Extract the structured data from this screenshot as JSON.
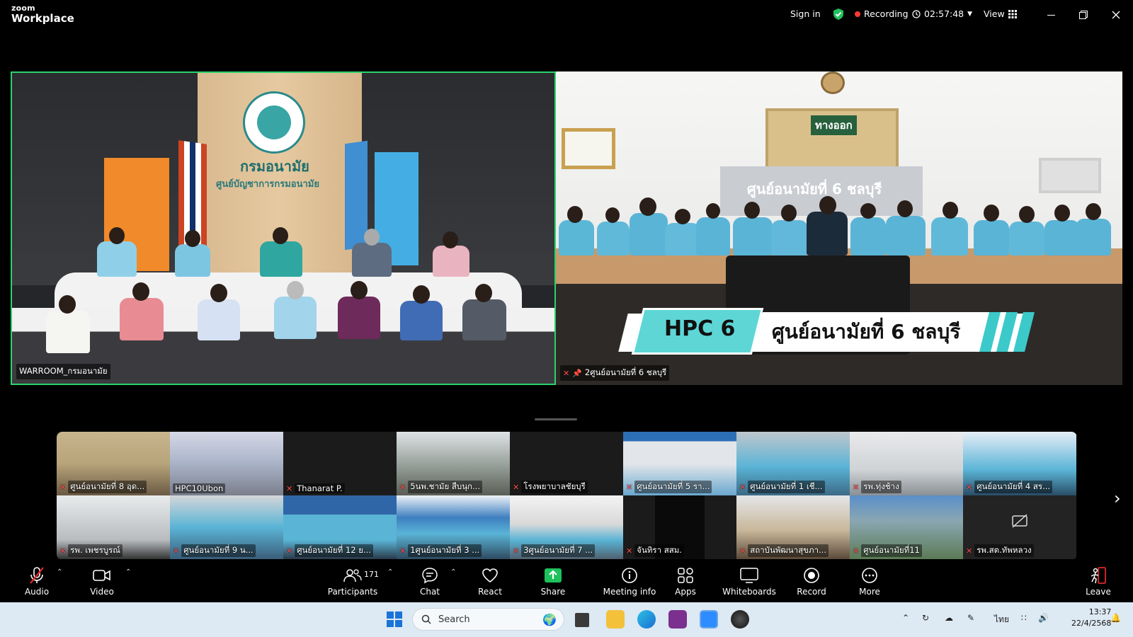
{
  "app": {
    "logo_top": "zoom",
    "logo_bottom": "Workplace"
  },
  "titlebar": {
    "sign_in": "Sign in",
    "recording": "Recording",
    "timer": "02:57:48",
    "view": "View"
  },
  "main_video": {
    "left_name": "WARROOM_กรมอนามัย",
    "right_name": "2ศูนย์อนามัยที่ 6 ชลบุรี",
    "right_banner_code": "HPC 6",
    "right_banner_text": "ศูนย์อนามัยที่ 6 ชลบุรี",
    "right_sign": "ศูนย์อนามัยที่ 6 ชลบุรี",
    "exit_sign": "ทางออก",
    "left_wall_text": "กรมอนามัย",
    "left_wall_sub": "ศูนย์บัญชาการกรมอนามัย"
  },
  "thumbnails_row1": [
    "ศูนย์อนามัยที่ 8 อุด...",
    "HPC10Ubon",
    "Thanarat P.",
    "5นพ.ชามัย สืบนุก...",
    "โรงพยาบาลชัยบุรี",
    "ศูนย์อนามัยที่ 5 รา...",
    "ศูนย์อนามัยที่ 1 เชี...",
    "รพ.ทุ่งช้าง",
    "ศูนย์อนามัยที่ 4 สร..."
  ],
  "thumbnails_row2": [
    "รพ. เพชรบูรณ์",
    "ศูนย์อนามัยที่ 9 น...",
    "ศูนย์อนามัยที่ 12 ย...",
    "1ศูนย์อนามัยที่ 3 ...",
    "3ศูนย์อนามัยที่ 7 ...",
    "จันทิรา สสม.",
    "สถาบันพัฒนาสุขภา...",
    "ศูนย์อนามัยที่11",
    "รพ.สต.ทัพหลวง"
  ],
  "toolbar": {
    "audio": "Audio",
    "video": "Video",
    "participants": "Participants",
    "participants_count": "171",
    "chat": "Chat",
    "react": "React",
    "share": "Share",
    "meeting_info": "Meeting info",
    "apps": "Apps",
    "whiteboards": "Whiteboards",
    "record": "Record",
    "more": "More",
    "leave": "Leave"
  },
  "taskbar": {
    "search_placeholder": "Search",
    "lang": "ไทย",
    "time": "13:37",
    "date": "22/4/2568"
  },
  "colors": {
    "active_speaker_border": "#2bd36b",
    "recording_dot": "#ff3b30",
    "share_green": "#1ec15b",
    "leave_red": "#e02828",
    "security_green": "#23c15e"
  }
}
